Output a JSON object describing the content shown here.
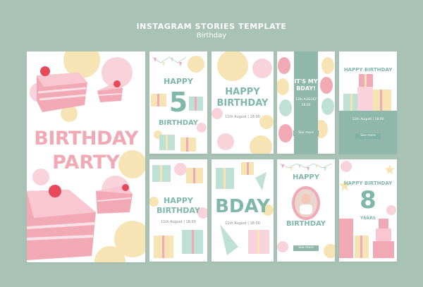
{
  "header": {
    "title": "INSTAGRAM STORIES TEMPLATE",
    "subtitle": "Birthday"
  },
  "colors": {
    "mint": "#7fb7a8",
    "pink": "#f1a9b6",
    "cream": "#f6e4b4",
    "bg": "#a8c3b5"
  },
  "cards": {
    "party": {
      "line1": "BIRTHDAY",
      "line2": "PARTY"
    },
    "five": {
      "happy": "HAPPY",
      "num": "5",
      "word": "BIRTHDAY"
    },
    "happy1": {
      "happy": "HAPPY",
      "birthday": "BIRTHDAY",
      "date": "11th August | 18:00"
    },
    "bday": {
      "line1": "IT'S MY",
      "line2": "BDAY!",
      "date": "11th AUGUST",
      "time": "18:00",
      "btn": "See more"
    },
    "gifts": {
      "happy": "HAPPY BIRTHDAY",
      "date": "11th August | 18:00",
      "btn": "See more"
    },
    "happy2": {
      "happy": "HAPPY",
      "birthday": "BIRTHDAY",
      "date": "11th August | 18:00"
    },
    "bdaybig": {
      "word": "BDAY",
      "date": "11th August | 18:00"
    },
    "photo": {
      "happy": "HAPPY",
      "birthday": "BIRTHDAY",
      "btn": "See more"
    },
    "eight": {
      "happy": "HAPPY BIRTHDAY",
      "num": "8",
      "years": "YEARS"
    }
  }
}
